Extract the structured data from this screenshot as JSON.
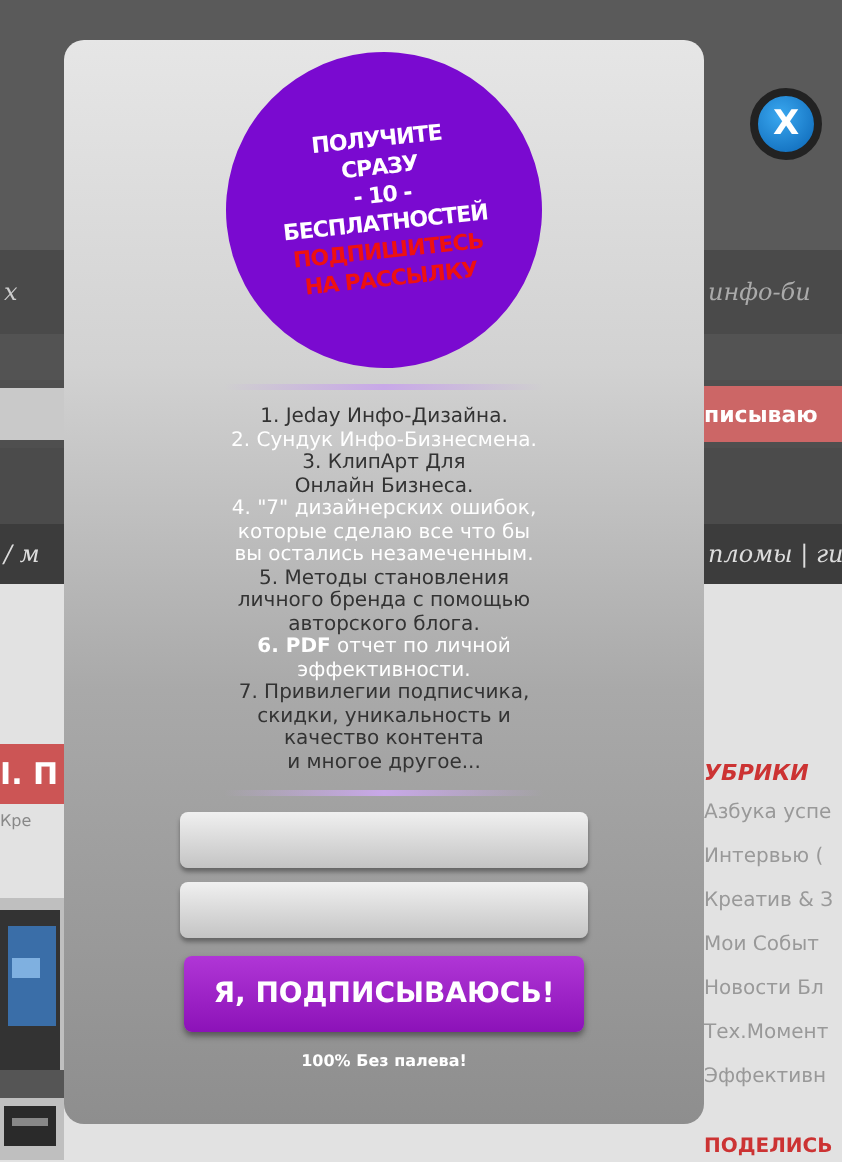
{
  "background_page": {
    "nav_left": "х",
    "nav_right": "инфо-би",
    "cta_button": "писываю",
    "menu_left": "/ м",
    "menu_right": "пломы | ги",
    "post_title": "I. П",
    "post_meta": "Кре",
    "sidebar_heading": "УБРИКИ",
    "sidebar_items": [
      "Азбука успе",
      "Интервью (",
      "Креатив & З",
      "Мои Событ",
      "Новости Бл",
      "Тех.Момент",
      "Эффективн"
    ],
    "share_heading": "ПОДЕЛИСЬ"
  },
  "popup": {
    "close_label": "X",
    "badge": [
      {
        "text": "ПОЛУЧИТЕ",
        "color": "#ffffff"
      },
      {
        "text": "СРАЗУ",
        "color": "#ffffff"
      },
      {
        "text": "- 10 -",
        "color": "#ffffff"
      },
      {
        "text": "БЕСПЛАТНОСТЕЙ",
        "color": "#ffffff"
      },
      {
        "text": "ПОДПИШИТЕСЬ",
        "color": "#ee1111"
      },
      {
        "text": "НА РАССЫЛКУ",
        "color": "#ee1111"
      }
    ],
    "benefits": [
      {
        "lines": [
          "1. Jeday Инфо-Дизайна."
        ],
        "color": "#333333"
      },
      {
        "lines": [
          "2. Сундук Инфо-Бизнесмена."
        ],
        "color": "#ffffff"
      },
      {
        "lines": [
          "3. КлипАрт Для",
          "Онлайн Бизнеса."
        ],
        "color": "#333333"
      },
      {
        "lines": [
          "4. \"7\" дизайнерских ошибок,",
          "которые сделаю все что бы",
          "вы остались незамеченным."
        ],
        "color": "#ffffff"
      },
      {
        "lines": [
          "5. Методы становления",
          "личного бренда с помощью",
          "авторского блога."
        ],
        "color": "#333333"
      },
      {
        "lines": [
          "**6. PDF** отчет по личной",
          "эффективности."
        ],
        "color": "#ffffff"
      },
      {
        "lines": [
          "7. Привилегии подписчика,",
          "скидки, уникальность и",
          "качество контента",
          "и многое другое..."
        ],
        "color": "#333333"
      }
    ],
    "submit_button": "Я, ПОДПИСЫВАЮСЬ!",
    "note": "100% Без палева!"
  }
}
